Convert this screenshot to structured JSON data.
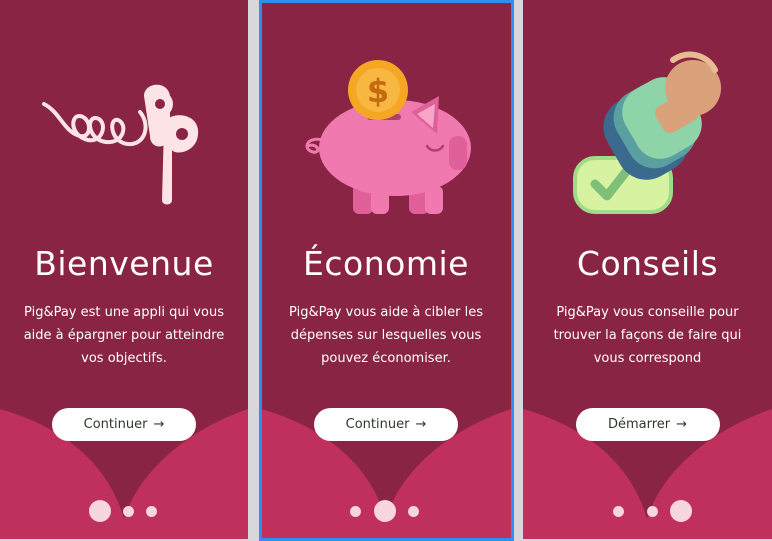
{
  "colors": {
    "screen_bg": "#8a2445",
    "wave": "#c0305d",
    "button_bg": "#ffffff",
    "text": "#ffffff",
    "selection": "#2e8ff0",
    "logo": "#fbe3e6",
    "pig": "#f07ab0",
    "coin": "#f5a623"
  },
  "screens": [
    {
      "title": "Bienvenue",
      "description": "Pig&Pay est une appli qui vous aide à épargner pour atteindre vos objectifs.",
      "button_label": "Continuer",
      "button_icon": "arrow-right-icon",
      "illustration": "pig-and-pay-logo",
      "active_dot": 0
    },
    {
      "title": "Économie",
      "description": "Pig&Pay vous aide à cibler les dépenses sur lesquelles vous pouvez économiser.",
      "button_label": "Continuer",
      "button_icon": "arrow-right-icon",
      "illustration": "piggy-bank-coin",
      "active_dot": 1
    },
    {
      "title": "Conseils",
      "description": "Pig&Pay vous conseille pour trouver la façons de faire qui vous correspond",
      "button_label": "Démarrer",
      "button_icon": "arrow-right-icon",
      "illustration": "approval-stamp",
      "active_dot": 2
    }
  ],
  "arrow_glyph": "→",
  "coin_symbol": "$"
}
